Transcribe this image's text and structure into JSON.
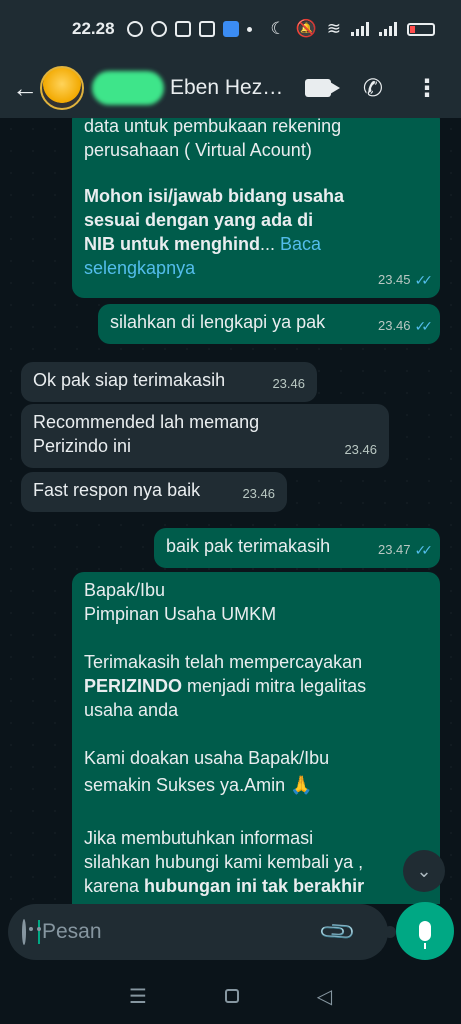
{
  "status_bar": {
    "time": "22.28"
  },
  "header": {
    "back_icon": "arrow-left-icon",
    "contact_name": "Eben Hez…",
    "icons": [
      "video-call-icon",
      "phone-icon",
      "more-vert-icon"
    ]
  },
  "messages": [
    {
      "dir": "out",
      "lines": [
        "data untuk pembukaan rekening",
        "perusahaan ( Virtual Acount)"
      ],
      "bold_lines": [
        "Mohon isi/jawab bidang usaha",
        "sesuai dengan yang ada di",
        "NIB untuk menghind"
      ],
      "ellipsis": "...",
      "read_more": "Baca selengkapnya",
      "time": "23.45"
    },
    {
      "dir": "out",
      "text": "silahkan di lengkapi ya pak",
      "time": "23.46"
    },
    {
      "dir": "in",
      "text": "Ok pak siap terimakasih",
      "time": "23.46"
    },
    {
      "dir": "in",
      "lines": [
        "Recommended lah memang",
        "Perizindo ini"
      ],
      "time": "23.46"
    },
    {
      "dir": "in",
      "text": "Fast respon nya baik",
      "time": "23.46"
    },
    {
      "dir": "out",
      "text": "baik pak terimakasih",
      "time": "23.47"
    },
    {
      "dir": "out",
      "p1": [
        "Bapak/Ibu",
        "Pimpinan Usaha UMKM"
      ],
      "p2_a": "Terimakasih telah mempercayakan",
      "p2_bold": "PERIZINDO",
      "p2_b": " menjadi mitra legalitas",
      "p2_c": "usaha anda",
      "p3": [
        "Kami doakan usaha Bapak/Ibu",
        "semakin Sukses ya.Amin 🙏"
      ],
      "p4_a": "Jika membutuhkan  informasi",
      "p4_b": "silahkan hubungi kami kembali ya ,",
      "p4_c": "karena ",
      "p4_bold": "hubungan ini tak berakhir"
    }
  ],
  "composer": {
    "placeholder": "Pesan"
  },
  "colors": {
    "outgoing": "#005c4b",
    "incoming": "#202c33",
    "accent": "#00a884",
    "read_ticks": "#53bdeb"
  }
}
